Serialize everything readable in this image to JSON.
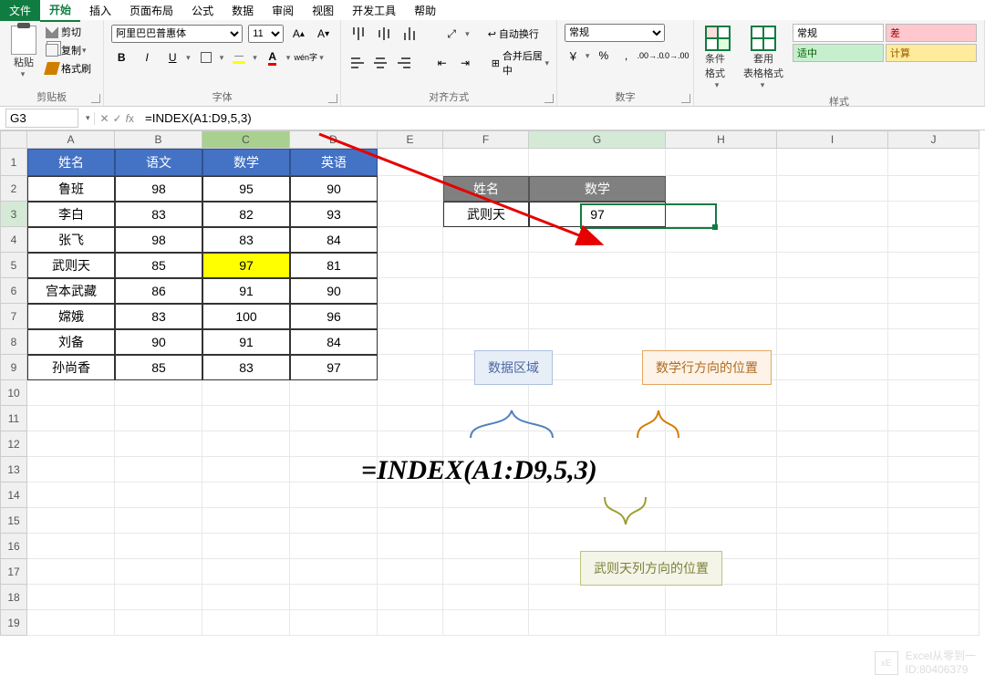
{
  "menu": {
    "file": "文件",
    "home": "开始",
    "insert": "插入",
    "layout": "页面布局",
    "formulas": "公式",
    "data": "数据",
    "review": "审阅",
    "view": "视图",
    "dev": "开发工具",
    "help": "帮助"
  },
  "ribbon": {
    "paste": "粘贴",
    "cut": "剪切",
    "copy": "复制",
    "brush": "格式刷",
    "clipboard": "剪贴板",
    "font_name": "阿里巴巴普惠体",
    "font_size": "11",
    "font_group": "字体",
    "wen": "wén",
    "zi": "字",
    "align_group": "对齐方式",
    "wrap": "自动换行",
    "merge": "合并后居中",
    "number_format": "常规",
    "number_group": "数字",
    "condfmt": "条件格式",
    "tblfmt": "套用\n表格格式",
    "style_normal": "常规",
    "style_bad": "差",
    "style_good": "适中",
    "style_calc": "计算",
    "styles_group": "样式"
  },
  "namebox": "G3",
  "formula": "=INDEX(A1:D9,5,3)",
  "cols": [
    "A",
    "B",
    "C",
    "D",
    "E",
    "F",
    "G",
    "H",
    "I",
    "J"
  ],
  "table": {
    "headers": [
      "姓名",
      "语文",
      "数学",
      "英语"
    ],
    "rows": [
      [
        "鲁班",
        "98",
        "95",
        "90"
      ],
      [
        "李白",
        "83",
        "82",
        "93"
      ],
      [
        "张飞",
        "98",
        "83",
        "84"
      ],
      [
        "武则天",
        "85",
        "97",
        "81"
      ],
      [
        "宫本武藏",
        "86",
        "91",
        "90"
      ],
      [
        "嫦娥",
        "83",
        "100",
        "96"
      ],
      [
        "刘备",
        "90",
        "91",
        "84"
      ],
      [
        "孙尚香",
        "85",
        "83",
        "97"
      ]
    ]
  },
  "lookup": {
    "h1": "姓名",
    "h2": "数学",
    "name": "武则天",
    "val": "97"
  },
  "callouts": {
    "range": "数据区域",
    "row": "数学行方向的位置",
    "col": "武则天列方向的位置"
  },
  "big_formula": "=INDEX(A1:D9,5,3)",
  "watermark": {
    "line1": "Excel从零到一",
    "line2": "ID:80406379",
    "logo": "xE"
  }
}
